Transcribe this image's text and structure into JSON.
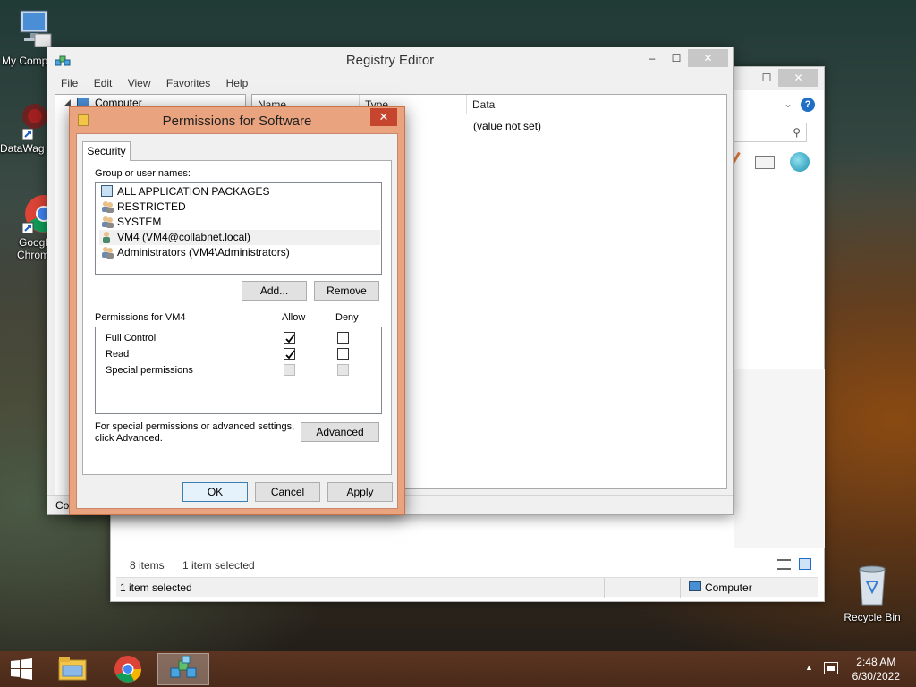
{
  "desktop": {
    "icons": [
      {
        "label": "My Comp",
        "icon": "computer-icon"
      },
      {
        "label": "DataWag",
        "icon": "datawag-app-icon"
      },
      {
        "label": "Googl\nChrom",
        "icon": "chrome-icon"
      },
      {
        "label": "Recycle Bin",
        "icon": "recycle-bin-icon"
      }
    ]
  },
  "explorer": {
    "status_items": "8 items",
    "status_selected": "1 item selected",
    "bottom_status": "1 item selected",
    "bottom_location": "Computer"
  },
  "regedit": {
    "title": "Registry Editor",
    "menu": [
      "File",
      "Edit",
      "View",
      "Favorites",
      "Help"
    ],
    "tree_root": "Computer",
    "columns": [
      "Name",
      "Type",
      "Data"
    ],
    "row_data": "(value not set)",
    "status_fragment": "Co"
  },
  "permissions": {
    "title": "Permissions for Software",
    "tab": "Security",
    "group_label": "Group or user names:",
    "users": [
      {
        "name": "ALL APPLICATION PACKAGES",
        "selected": false
      },
      {
        "name": "RESTRICTED",
        "selected": false
      },
      {
        "name": "SYSTEM",
        "selected": false
      },
      {
        "name": "VM4 (VM4@collabnet.local)",
        "selected": true
      },
      {
        "name": "Administrators (VM4\\Administrators)",
        "selected": false
      }
    ],
    "add_label": "Add...",
    "remove_label": "Remove",
    "perm_label": "Permissions for VM4",
    "allow_label": "Allow",
    "deny_label": "Deny",
    "perms": [
      {
        "name": "Full Control",
        "allow": true,
        "deny": false,
        "disabled": false
      },
      {
        "name": "Read",
        "allow": true,
        "deny": false,
        "disabled": false
      },
      {
        "name": "Special permissions",
        "allow": false,
        "deny": false,
        "disabled": true
      }
    ],
    "advanced_text_1": "For special permissions or advanced settings,",
    "advanced_text_2": "click Advanced.",
    "advanced_label": "Advanced",
    "ok_label": "OK",
    "cancel_label": "Cancel",
    "apply_label": "Apply"
  },
  "taskbar": {
    "time": "2:48 AM",
    "date": "6/30/2022"
  }
}
